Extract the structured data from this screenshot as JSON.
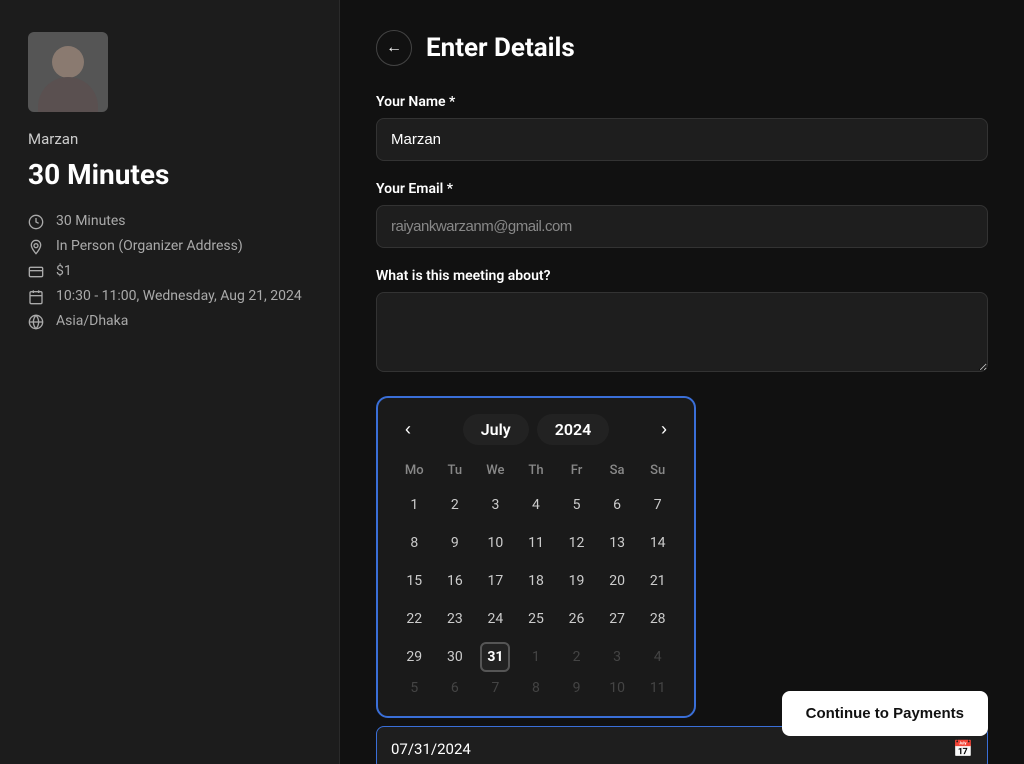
{
  "sidebar": {
    "host_name": "Marzan",
    "meeting_title": "30 Minutes",
    "details": [
      {
        "id": "duration",
        "icon": "clock",
        "text": "30 Minutes"
      },
      {
        "id": "location",
        "icon": "location",
        "text": "In Person (Organizer Address)"
      },
      {
        "id": "price",
        "icon": "dollar",
        "text": "$1"
      },
      {
        "id": "time",
        "icon": "calendar",
        "text": "10:30 - 11:00, Wednesday, Aug 21, 2024"
      },
      {
        "id": "timezone",
        "icon": "globe",
        "text": "Asia/Dhaka"
      }
    ]
  },
  "form": {
    "title": "Enter Details",
    "back_button": "←",
    "name_label": "Your Name *",
    "name_value": "Marzan",
    "email_label": "Your Email *",
    "email_value": "raiyankwarzanm@gmail.com",
    "meeting_about_label": "What is this meeting about?",
    "meeting_about_placeholder": ""
  },
  "calendar": {
    "month": "July",
    "year": "2024",
    "prev_nav": "‹",
    "next_nav": "›",
    "weekdays": [
      "Mo",
      "Tu",
      "We",
      "Th",
      "Fr",
      "Sa",
      "Su"
    ],
    "weeks": [
      [
        {
          "d": "1",
          "m": "cur"
        },
        {
          "d": "2",
          "m": "cur"
        },
        {
          "d": "3",
          "m": "cur"
        },
        {
          "d": "4",
          "m": "cur"
        },
        {
          "d": "5",
          "m": "cur"
        },
        {
          "d": "6",
          "m": "cur"
        },
        {
          "d": "7",
          "m": "cur"
        }
      ],
      [
        {
          "d": "8",
          "m": "cur"
        },
        {
          "d": "9",
          "m": "cur"
        },
        {
          "d": "10",
          "m": "cur"
        },
        {
          "d": "11",
          "m": "cur"
        },
        {
          "d": "12",
          "m": "cur"
        },
        {
          "d": "13",
          "m": "cur"
        },
        {
          "d": "14",
          "m": "cur"
        }
      ],
      [
        {
          "d": "15",
          "m": "cur"
        },
        {
          "d": "16",
          "m": "cur"
        },
        {
          "d": "17",
          "m": "cur"
        },
        {
          "d": "18",
          "m": "cur"
        },
        {
          "d": "19",
          "m": "cur"
        },
        {
          "d": "20",
          "m": "cur"
        },
        {
          "d": "21",
          "m": "cur"
        }
      ],
      [
        {
          "d": "22",
          "m": "cur"
        },
        {
          "d": "23",
          "m": "cur"
        },
        {
          "d": "24",
          "m": "cur"
        },
        {
          "d": "25",
          "m": "cur"
        },
        {
          "d": "26",
          "m": "cur"
        },
        {
          "d": "27",
          "m": "cur"
        },
        {
          "d": "28",
          "m": "cur"
        }
      ],
      [
        {
          "d": "29",
          "m": "cur"
        },
        {
          "d": "30",
          "m": "cur"
        },
        {
          "d": "31",
          "m": "cur",
          "sel": true
        },
        {
          "d": "1",
          "m": "next"
        },
        {
          "d": "2",
          "m": "next"
        },
        {
          "d": "3",
          "m": "next"
        },
        {
          "d": "4",
          "m": "next"
        }
      ],
      [
        {
          "d": "5",
          "m": "next"
        },
        {
          "d": "6",
          "m": "next"
        },
        {
          "d": "7",
          "m": "next"
        },
        {
          "d": "8",
          "m": "next"
        },
        {
          "d": "9",
          "m": "next"
        },
        {
          "d": "10",
          "m": "next"
        },
        {
          "d": "11",
          "m": "next"
        }
      ]
    ],
    "selected_date": "07/31/2024"
  },
  "actions": {
    "continue_label": "Continue to Payments"
  }
}
